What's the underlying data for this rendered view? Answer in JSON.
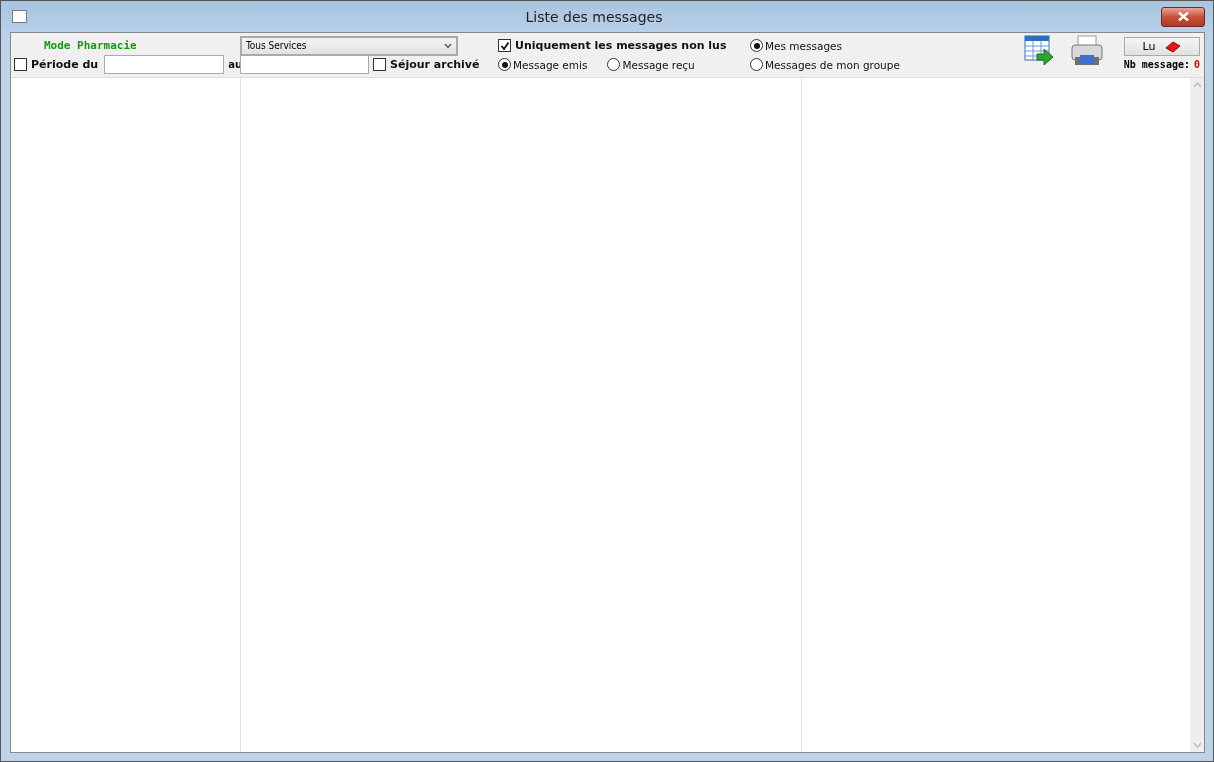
{
  "window": {
    "title": "Liste des messages"
  },
  "mode_label": "Mode Pharmacie",
  "period": {
    "label": "Période du",
    "checked": false,
    "to_label": "au"
  },
  "service_select": {
    "value": "Tous Services"
  },
  "archived": {
    "label": "Séjour archivé",
    "checked": false
  },
  "unread_only": {
    "label": "Uniquement les messages non lus",
    "checked": true
  },
  "direction": [
    {
      "label": "Message emis",
      "selected": true
    },
    {
      "label": "Message reçu",
      "selected": false
    }
  ],
  "scope": [
    {
      "label": "Mes messages",
      "selected": true
    },
    {
      "label": "Messages de mon groupe",
      "selected": false
    }
  ],
  "read_button": {
    "label": "Lu"
  },
  "count": {
    "label": "Nb message:",
    "value": "0"
  }
}
